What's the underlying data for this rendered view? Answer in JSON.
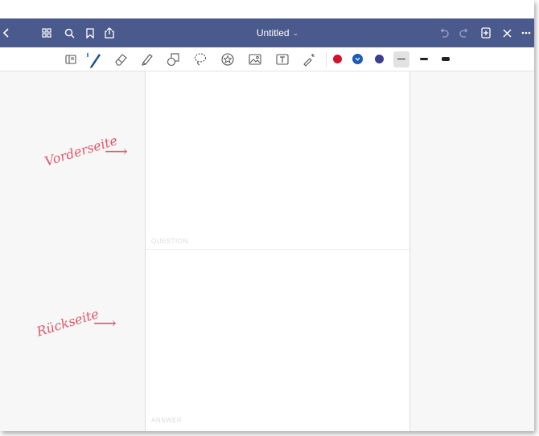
{
  "titlebar": {
    "title": "Untitled",
    "title_chevron": "⌄",
    "left_icons": [
      "back-chevron-icon",
      "grid-icon",
      "search-icon",
      "bookmark-icon",
      "share-icon"
    ],
    "right_icons": [
      "undo-icon",
      "redo-icon",
      "add-page-icon",
      "close-icon",
      "more-icon"
    ],
    "bg_color": "#4b5a8c"
  },
  "toolbar": {
    "tools": [
      "page-view-icon",
      "pen-icon",
      "eraser-icon",
      "highlighter-icon",
      "shapes-icon",
      "lasso-icon",
      "sticker-icon",
      "image-icon",
      "text-icon",
      "laser-pointer-icon"
    ],
    "active_tool": "pen-icon",
    "colors": [
      "#d0142b",
      "#1d5ab4",
      "#3c3d8e"
    ],
    "selected_color": "#1d5ab4",
    "stroke_widths": [
      "thin",
      "medium",
      "thick"
    ],
    "selected_width": "thin"
  },
  "page": {
    "top_label": "QUESTION",
    "bottom_label": "ANSWER"
  },
  "annotations": {
    "front": "Vorderseite",
    "back": "Rückseite",
    "arrow": "⟶",
    "color": "#e0566b"
  }
}
